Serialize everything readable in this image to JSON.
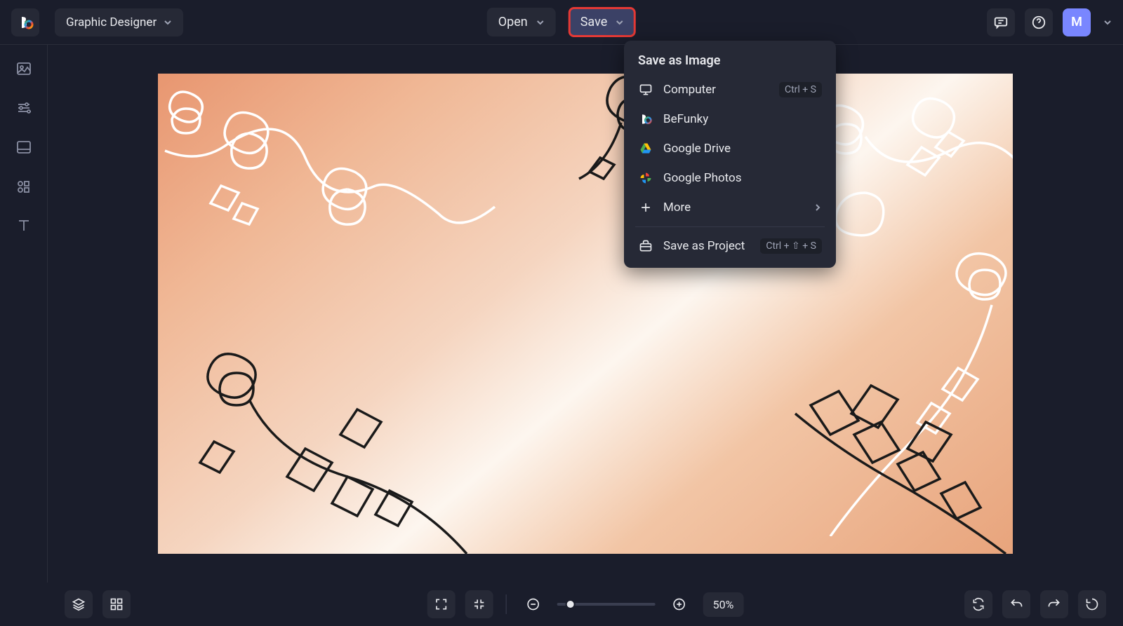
{
  "header": {
    "mode_label": "Graphic Designer",
    "open_label": "Open",
    "save_label": "Save",
    "avatar_initial": "M"
  },
  "dropdown": {
    "header": "Save as Image",
    "items": [
      {
        "label": "Computer",
        "shortcut": "Ctrl + S",
        "icon": "monitor"
      },
      {
        "label": "BeFunky",
        "icon": "befunky"
      },
      {
        "label": "Google Drive",
        "icon": "gdrive"
      },
      {
        "label": "Google Photos",
        "icon": "gphotos"
      },
      {
        "label": "More",
        "icon": "plus",
        "submenu": true
      }
    ],
    "project": {
      "label": "Save as Project",
      "shortcut": "Ctrl + ⇧ + S",
      "icon": "briefcase"
    }
  },
  "bottom": {
    "zoom_label": "50%"
  }
}
